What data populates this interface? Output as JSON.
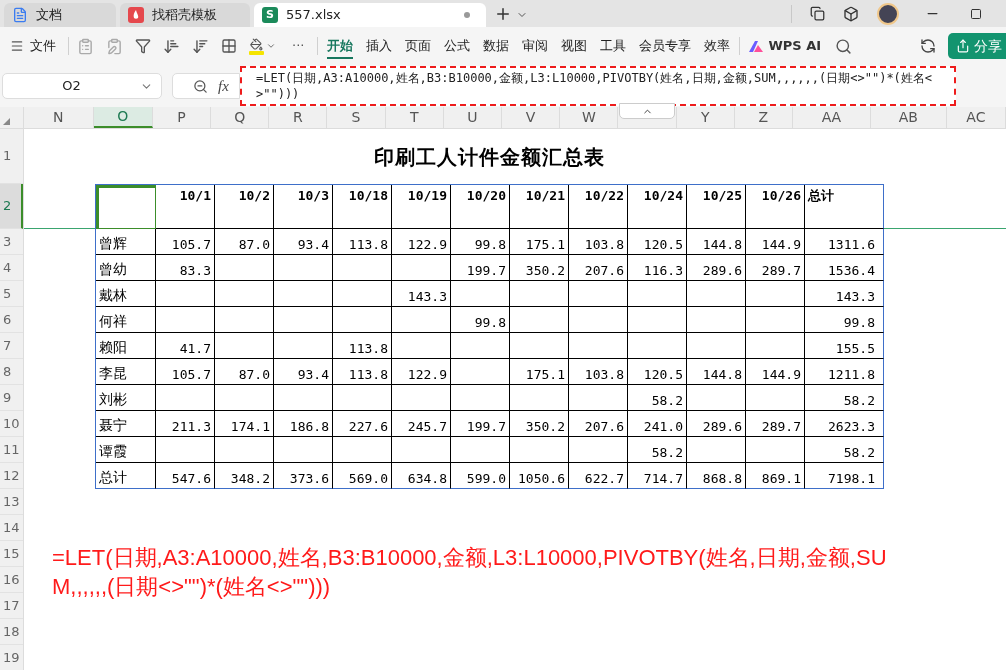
{
  "tabs": [
    {
      "label": "文档",
      "selected": false,
      "color": "#3b7cf0",
      "kind": "doc"
    },
    {
      "label": "找稻壳模板",
      "selected": false,
      "color": "#e5484d",
      "kind": "template"
    },
    {
      "label": "557.xlsx",
      "selected": true,
      "color": "#1b8a5a",
      "kind": "sheet",
      "icon_letter": "S",
      "unsaved": true
    }
  ],
  "menu": {
    "label": "文件"
  },
  "more": "···",
  "ribbon_tabs": [
    {
      "label": "开始",
      "selected": true
    },
    {
      "label": "插入",
      "selected": false
    },
    {
      "label": "页面",
      "selected": false
    },
    {
      "label": "公式",
      "selected": false
    },
    {
      "label": "数据",
      "selected": false
    },
    {
      "label": "审阅",
      "selected": false
    },
    {
      "label": "视图",
      "selected": false
    },
    {
      "label": "工具",
      "selected": false
    },
    {
      "label": "会员专享",
      "selected": false
    },
    {
      "label": "效率",
      "selected": false
    }
  ],
  "ai_button": "WPS AI",
  "share_button": "分享",
  "name_box": "O2",
  "fx": "fx",
  "formula": "=LET(日期,A3:A10000,姓名,B3:B10000,金额,L3:L10000,PIVOTBY(姓名,日期,金额,SUM,,,,,,(日期<>\"\")*(姓名<>\"\")))",
  "column_headers": [
    {
      "kind": "column",
      "label": "N",
      "selected": false
    },
    {
      "kind": "column",
      "label": "O",
      "selected": true
    },
    {
      "kind": "column",
      "label": "P",
      "selected": false
    },
    {
      "kind": "column",
      "label": "Q",
      "selected": false
    },
    {
      "kind": "column",
      "label": "R",
      "selected": false
    },
    {
      "kind": "column",
      "label": "S",
      "selected": false
    },
    {
      "kind": "column",
      "label": "T",
      "selected": false
    },
    {
      "kind": "column",
      "label": "U",
      "selected": false
    },
    {
      "kind": "column",
      "label": "V",
      "selected": false
    },
    {
      "kind": "column",
      "label": "W",
      "selected": false
    },
    {
      "kind": "collapse"
    },
    {
      "kind": "column",
      "label": "Y",
      "selected": false
    },
    {
      "kind": "column",
      "label": "Z",
      "selected": false
    },
    {
      "kind": "column",
      "label": "AA",
      "selected": false
    },
    {
      "kind": "column",
      "label": "AB",
      "selected": false
    },
    {
      "kind": "column",
      "label": "AC",
      "selected": false
    }
  ],
  "row_headers": [
    {
      "label": "1",
      "selected": false
    },
    {
      "label": "2",
      "selected": true
    },
    {
      "label": "3",
      "selected": false
    },
    {
      "label": "4",
      "selected": false
    },
    {
      "label": "5",
      "selected": false
    },
    {
      "label": "6",
      "selected": false
    },
    {
      "label": "7",
      "selected": false
    },
    {
      "label": "8",
      "selected": false
    },
    {
      "label": "9",
      "selected": false
    },
    {
      "label": "10",
      "selected": false
    },
    {
      "label": "11",
      "selected": false
    },
    {
      "label": "12",
      "selected": false
    },
    {
      "label": "13",
      "selected": false
    },
    {
      "label": "14",
      "selected": false
    },
    {
      "label": "15",
      "selected": false
    },
    {
      "label": "16",
      "selected": false
    },
    {
      "label": "17",
      "selected": false
    },
    {
      "label": "18",
      "selected": false
    },
    {
      "label": "19",
      "selected": false
    }
  ],
  "sheet_title": "印刷工人计件金额汇总表",
  "table": {
    "corner_selected": true,
    "headers": [
      "10/1",
      "10/2",
      "10/3",
      "10/18",
      "10/19",
      "10/20",
      "10/21",
      "10/22",
      "10/24",
      "10/25",
      "10/26",
      "总计"
    ],
    "rows": [
      {
        "name": "曾辉",
        "cells": [
          {
            "kind": "value",
            "text": "105.7"
          },
          {
            "kind": "value",
            "text": "87.0"
          },
          {
            "kind": "value",
            "text": "93.4"
          },
          {
            "kind": "value",
            "text": "113.8"
          },
          {
            "kind": "value",
            "text": "122.9"
          },
          {
            "kind": "value",
            "text": "99.8"
          },
          {
            "kind": "value",
            "text": "175.1"
          },
          {
            "kind": "value",
            "text": "103.8"
          },
          {
            "kind": "value",
            "text": "120.5"
          },
          {
            "kind": "value",
            "text": "144.8"
          },
          {
            "kind": "value",
            "text": "144.9"
          }
        ],
        "total": "1311.6"
      },
      {
        "name": "曾幼",
        "cells": [
          {
            "kind": "value",
            "text": "83.3"
          },
          {
            "kind": "blank"
          },
          {
            "kind": "blank"
          },
          {
            "kind": "blank"
          },
          {
            "kind": "blank"
          },
          {
            "kind": "value",
            "text": "199.7"
          },
          {
            "kind": "value",
            "text": "350.2"
          },
          {
            "kind": "value",
            "text": "207.6"
          },
          {
            "kind": "value",
            "text": "116.3"
          },
          {
            "kind": "value",
            "text": "289.6"
          },
          {
            "kind": "value",
            "text": "289.7"
          }
        ],
        "total": "1536.4"
      },
      {
        "name": "戴林",
        "cells": [
          {
            "kind": "blank"
          },
          {
            "kind": "blank"
          },
          {
            "kind": "blank"
          },
          {
            "kind": "blank"
          },
          {
            "kind": "value",
            "text": "143.3"
          },
          {
            "kind": "blank"
          },
          {
            "kind": "blank"
          },
          {
            "kind": "blank"
          },
          {
            "kind": "blank"
          },
          {
            "kind": "blank"
          },
          {
            "kind": "blank"
          }
        ],
        "total": "143.3"
      },
      {
        "name": "何祥",
        "cells": [
          {
            "kind": "blank"
          },
          {
            "kind": "blank"
          },
          {
            "kind": "blank"
          },
          {
            "kind": "blank"
          },
          {
            "kind": "blank"
          },
          {
            "kind": "value",
            "text": "99.8"
          },
          {
            "kind": "blank"
          },
          {
            "kind": "blank"
          },
          {
            "kind": "blank"
          },
          {
            "kind": "blank"
          },
          {
            "kind": "blank"
          }
        ],
        "total": "99.8"
      },
      {
        "name": "赖阳",
        "cells": [
          {
            "kind": "value",
            "text": "41.7"
          },
          {
            "kind": "blank"
          },
          {
            "kind": "blank"
          },
          {
            "kind": "value",
            "text": "113.8"
          },
          {
            "kind": "blank"
          },
          {
            "kind": "blank"
          },
          {
            "kind": "blank"
          },
          {
            "kind": "blank"
          },
          {
            "kind": "blank"
          },
          {
            "kind": "blank"
          },
          {
            "kind": "blank"
          }
        ],
        "total": "155.5"
      },
      {
        "name": "李昆",
        "cells": [
          {
            "kind": "value",
            "text": "105.7"
          },
          {
            "kind": "value",
            "text": "87.0"
          },
          {
            "kind": "value",
            "text": "93.4"
          },
          {
            "kind": "value",
            "text": "113.8"
          },
          {
            "kind": "value",
            "text": "122.9"
          },
          {
            "kind": "blank"
          },
          {
            "kind": "value",
            "text": "175.1"
          },
          {
            "kind": "value",
            "text": "103.8"
          },
          {
            "kind": "value",
            "text": "120.5"
          },
          {
            "kind": "value",
            "text": "144.8"
          },
          {
            "kind": "value",
            "text": "144.9"
          }
        ],
        "total": "1211.8"
      },
      {
        "name": "刘彬",
        "cells": [
          {
            "kind": "blank"
          },
          {
            "kind": "blank"
          },
          {
            "kind": "blank"
          },
          {
            "kind": "blank"
          },
          {
            "kind": "blank"
          },
          {
            "kind": "blank"
          },
          {
            "kind": "blank"
          },
          {
            "kind": "blank"
          },
          {
            "kind": "value",
            "text": "58.2"
          },
          {
            "kind": "blank"
          },
          {
            "kind": "blank"
          }
        ],
        "total": "58.2"
      },
      {
        "name": "聂宁",
        "cells": [
          {
            "kind": "value",
            "text": "211.3"
          },
          {
            "kind": "value",
            "text": "174.1"
          },
          {
            "kind": "value",
            "text": "186.8"
          },
          {
            "kind": "value",
            "text": "227.6"
          },
          {
            "kind": "value",
            "text": "245.7"
          },
          {
            "kind": "value",
            "text": "199.7"
          },
          {
            "kind": "value",
            "text": "350.2"
          },
          {
            "kind": "value",
            "text": "207.6"
          },
          {
            "kind": "value",
            "text": "241.0"
          },
          {
            "kind": "value",
            "text": "289.6"
          },
          {
            "kind": "value",
            "text": "289.7"
          }
        ],
        "total": "2623.3"
      },
      {
        "name": "谭霞",
        "cells": [
          {
            "kind": "blank"
          },
          {
            "kind": "blank"
          },
          {
            "kind": "blank"
          },
          {
            "kind": "blank"
          },
          {
            "kind": "blank"
          },
          {
            "kind": "blank"
          },
          {
            "kind": "blank"
          },
          {
            "kind": "blank"
          },
          {
            "kind": "value",
            "text": "58.2"
          },
          {
            "kind": "blank"
          },
          {
            "kind": "blank"
          }
        ],
        "total": "58.2"
      },
      {
        "name": "总计",
        "cells": [
          {
            "kind": "value",
            "text": "547.6"
          },
          {
            "kind": "value",
            "text": "348.2"
          },
          {
            "kind": "value",
            "text": "373.6"
          },
          {
            "kind": "value",
            "text": "569.0"
          },
          {
            "kind": "value",
            "text": "634.8"
          },
          {
            "kind": "value",
            "text": "599.0"
          },
          {
            "kind": "value",
            "text": "1050.6"
          },
          {
            "kind": "value",
            "text": "622.7"
          },
          {
            "kind": "value",
            "text": "714.7"
          },
          {
            "kind": "value",
            "text": "868.8"
          },
          {
            "kind": "value",
            "text": "869.1"
          }
        ],
        "total": "7198.1"
      }
    ]
  },
  "note": "=LET(日期,A3:A10000,姓名,B3:B10000,金额,L3:L10000,PIVOTBY(姓名,日期,金额,SUM,,,,,,(日期<>\"\")*(姓名<>\"\")))"
}
